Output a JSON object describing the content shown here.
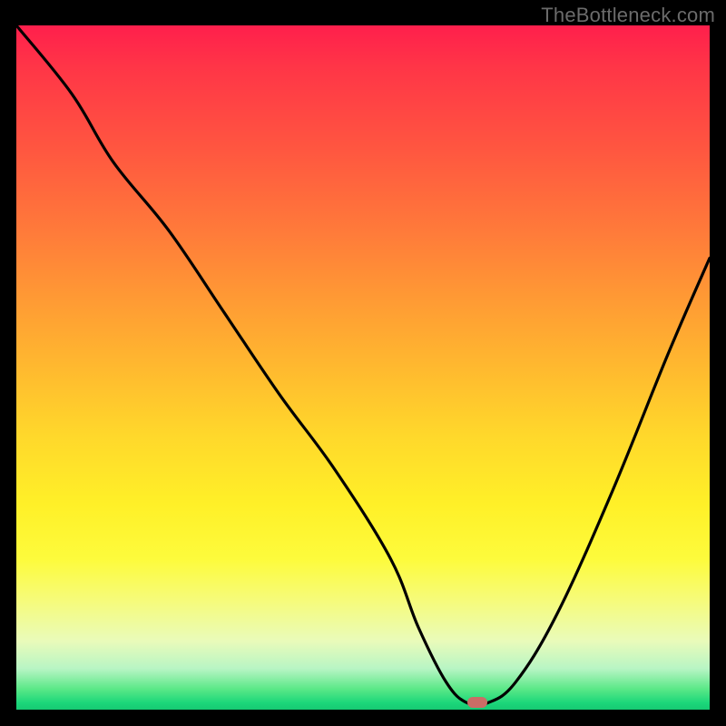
{
  "watermark": "TheBottleneck.com",
  "colors": {
    "background": "#000000",
    "gradient_top": "#ff1f4c",
    "gradient_bottom": "#16c973",
    "curve": "#000000",
    "marker": "#cb6c66",
    "watermark": "#6b6b6b"
  },
  "chart_data": {
    "type": "line",
    "title": "",
    "xlabel": "",
    "ylabel": "",
    "xlim": [
      0,
      100
    ],
    "ylim": [
      0,
      100
    ],
    "grid": false,
    "legend": false,
    "series": [
      {
        "name": "bottleneck-curve",
        "x": [
          0,
          8,
          14,
          22,
          30,
          38,
          46,
          54,
          58,
          62,
          65,
          68,
          72,
          78,
          86,
          94,
          100
        ],
        "values": [
          100,
          90,
          80,
          70,
          58,
          46,
          35,
          22,
          12,
          4,
          1,
          1,
          4,
          14,
          32,
          52,
          66
        ]
      }
    ],
    "marker": {
      "x": 66.5,
      "y": 1,
      "label": ""
    },
    "axes_visible": false
  }
}
